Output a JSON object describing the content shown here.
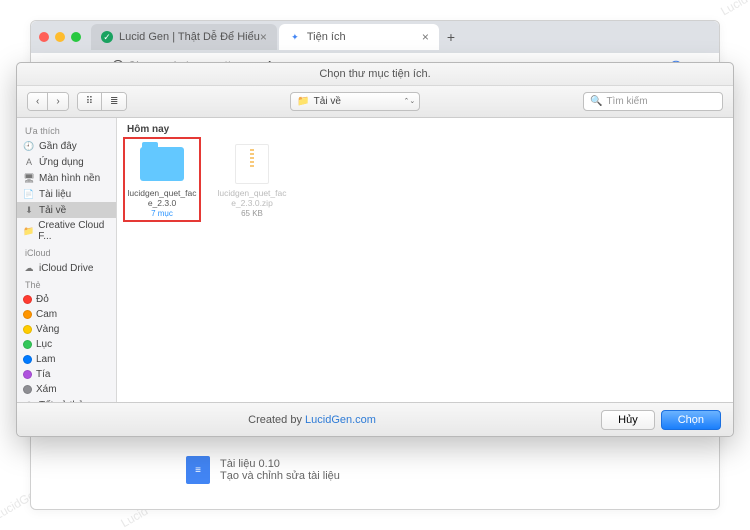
{
  "browser": {
    "tabs": [
      {
        "label": "Lucid Gen | Thật Dễ Để Hiểu"
      },
      {
        "label": "Tiện ích"
      }
    ],
    "newtab_glyph": "+",
    "url_prefix": "Chrome | ",
    "url_host": "chrome://",
    "url_path": "extensions",
    "star_glyph": "☆",
    "menu_glyph": "⋮"
  },
  "finder": {
    "title": "Chọn thư mục tiện ích.",
    "nav": {
      "back": "‹",
      "forward": "›",
      "view1": "⠿",
      "view2": "≣"
    },
    "path_label": "Tải về",
    "search_placeholder": "Tìm kiếm",
    "section": "Hôm nay",
    "items": [
      {
        "name": "lucidgen_quet_face_2.3.0",
        "meta": "7 mục",
        "kind": "folder"
      },
      {
        "name": "lucidgen_quet_face_2.3.0.zip",
        "meta": "65 KB",
        "kind": "zip"
      }
    ],
    "credit_prefix": "Created by ",
    "credit_link": "LucidGen.com",
    "btn_cancel": "Hủy",
    "btn_choose": "Chọn"
  },
  "sidebar": {
    "favorites_head": "Ưa thích",
    "favorites": [
      {
        "label": "Gần đây",
        "glyph": "🕘"
      },
      {
        "label": "Ứng dụng",
        "glyph": "A"
      },
      {
        "label": "Màn hình nền",
        "glyph": "🖥"
      },
      {
        "label": "Tài liệu",
        "glyph": "📄"
      },
      {
        "label": "Tải về",
        "glyph": "⬇",
        "selected": true
      },
      {
        "label": "Creative Cloud F...",
        "glyph": "📁"
      }
    ],
    "icloud_head": "iCloud",
    "icloud": [
      {
        "label": "iCloud Drive",
        "glyph": "☁"
      }
    ],
    "tags_head": "Thẻ",
    "tags": [
      {
        "label": "Đỏ",
        "color": "#ff3b30"
      },
      {
        "label": "Cam",
        "color": "#ff9500"
      },
      {
        "label": "Vàng",
        "color": "#ffcc00"
      },
      {
        "label": "Lục",
        "color": "#34c759"
      },
      {
        "label": "Lam",
        "color": "#007aff"
      },
      {
        "label": "Tía",
        "color": "#af52de"
      },
      {
        "label": "Xám",
        "color": "#8e8e93"
      },
      {
        "label": "Tất cả thẻ...",
        "glyph": "⚙"
      }
    ]
  },
  "behind": {
    "line1": "Tài liệu  0.10",
    "line2": "Tạo và chỉnh sửa tài liệu"
  }
}
